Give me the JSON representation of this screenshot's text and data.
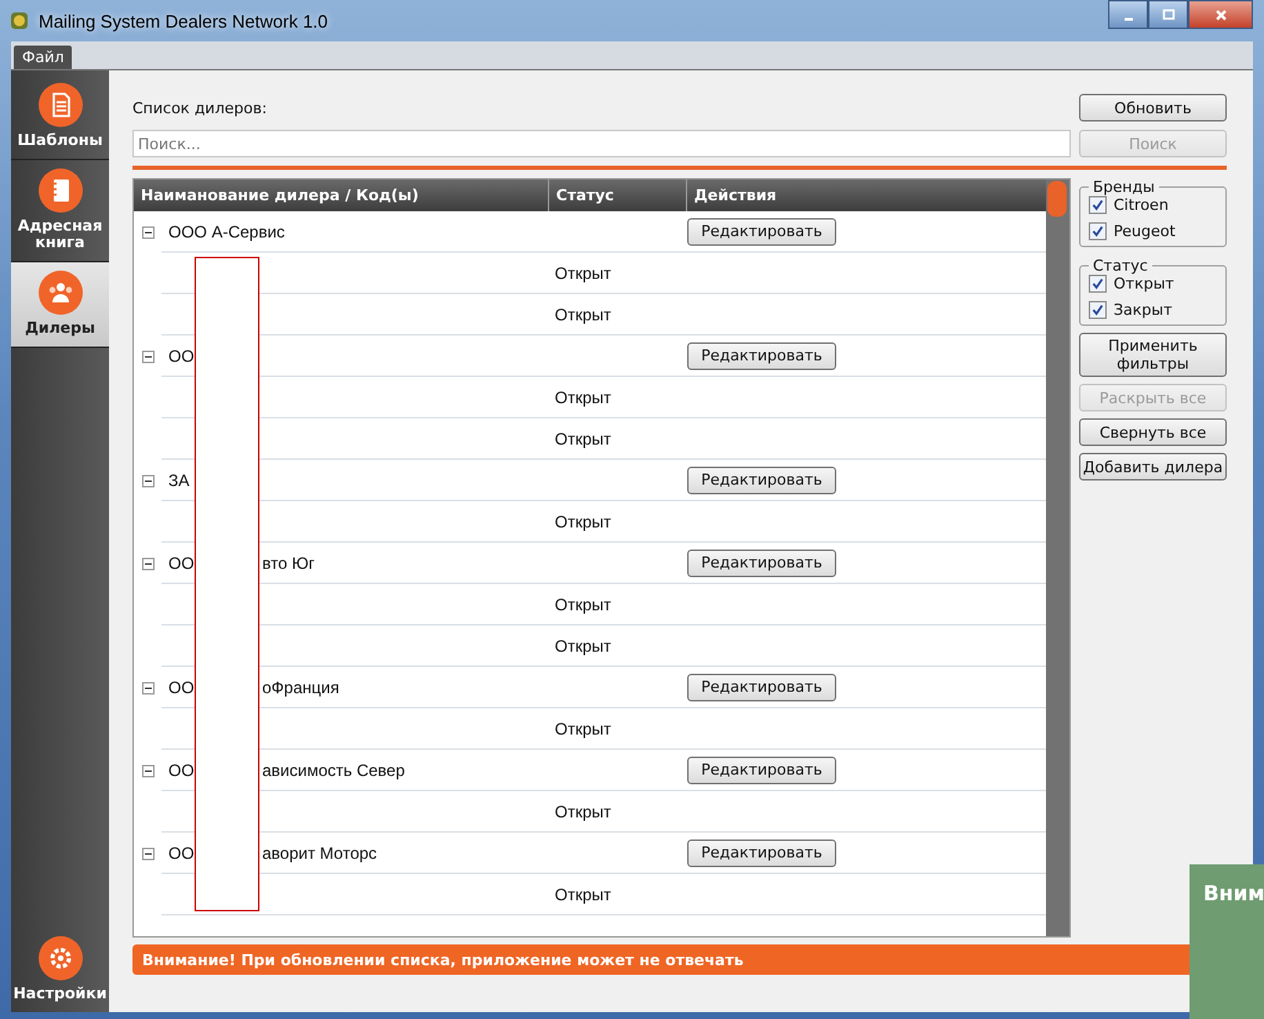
{
  "window": {
    "title": "Mailing System Dealers Network 1.0"
  },
  "menu": [
    {
      "label": "Файл"
    }
  ],
  "sidebar": {
    "items": [
      {
        "label": "Шаблоны",
        "selected": false
      },
      {
        "label": "Адресная книга",
        "selected": false
      },
      {
        "label": "Дилеры",
        "selected": true
      }
    ],
    "bottom_item": {
      "label": "Настройки",
      "selected": false
    }
  },
  "list_label": "Список дилеров:",
  "refresh_button": {
    "label": "Обновить",
    "disabled": false
  },
  "search": {
    "placeholder": "Поиск..."
  },
  "search_button": {
    "label": "Поиск",
    "disabled": true
  },
  "table": {
    "columns": [
      "Наиманование дилера / Код(ы)",
      "Статус",
      "Действия"
    ],
    "dealers": [
      {
        "name_start": "ООО А-Сервис",
        "edit_label": "Редактировать",
        "expanded": true,
        "children": [
          {
            "status": "Открыт"
          },
          {
            "status": "Открыт"
          }
        ]
      },
      {
        "name_start": "ОО",
        "edit_label": "Редактировать",
        "expanded": true,
        "children": [
          {
            "status": "Открыт"
          },
          {
            "status": "Открыт"
          }
        ]
      },
      {
        "name_start": "ЗА",
        "edit_label": "Редактировать",
        "expanded": true,
        "children": [
          {
            "status": "Открыт"
          }
        ]
      },
      {
        "name_start": "ОО",
        "name_end": "вто Юг",
        "edit_label": "Редактировать",
        "expanded": true,
        "children": [
          {
            "status": "Открыт"
          },
          {
            "status": "Открыт"
          }
        ]
      },
      {
        "name_start": "ОО",
        "name_end": "оФранция",
        "edit_label": "Редактировать",
        "expanded": true,
        "children": [
          {
            "status": "Открыт"
          }
        ]
      },
      {
        "name_start": "ОО",
        "name_end": "ависимость Север",
        "edit_label": "Редактировать",
        "expanded": true,
        "children": [
          {
            "status": "Открыт"
          }
        ]
      },
      {
        "name_start": "ОО",
        "name_end": "аворит Моторс",
        "edit_label": "Редактировать",
        "expanded": true,
        "children": [
          {
            "status": "Открыт"
          }
        ]
      }
    ]
  },
  "filters": [
    {
      "title": "Бренды",
      "options": [
        {
          "label": "Citroen",
          "checked": true
        },
        {
          "label": "Peugeot",
          "checked": true
        }
      ]
    },
    {
      "title": "Статус",
      "options": [
        {
          "label": "Открыт",
          "checked": true
        },
        {
          "label": "Закрыт",
          "checked": true
        }
      ]
    }
  ],
  "actions": [
    {
      "label": "Применить фильтры",
      "disabled": false
    },
    {
      "label": "Раскрыть все",
      "disabled": true
    },
    {
      "label": "Свернуть все",
      "disabled": false
    },
    {
      "label": "Добавить дилера",
      "disabled": false
    }
  ],
  "warning": "Внимание! При обновлении списка, приложение может не отвечать",
  "notification": {
    "title": "Вним"
  }
}
